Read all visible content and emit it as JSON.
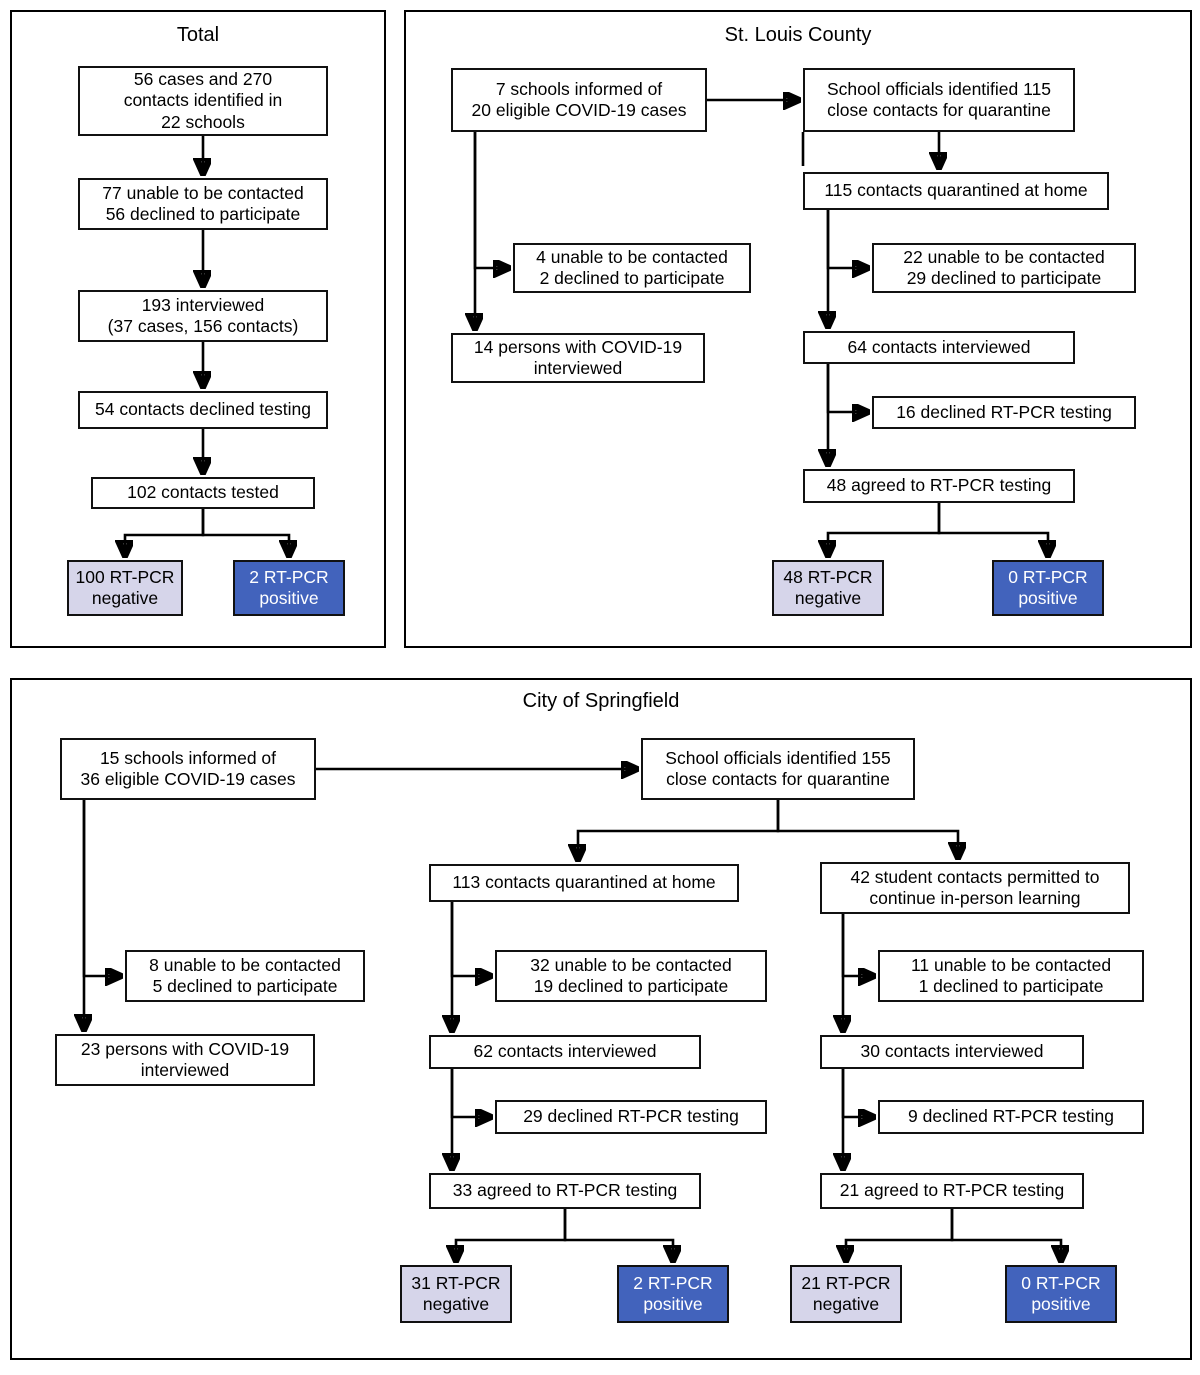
{
  "figure": {
    "panels": [
      {
        "id": "total",
        "title": "Total",
        "nodes": [
          {
            "id": "t1",
            "label": "56 cases and 270\ncontacts identified in\n22 schools",
            "style": "plain"
          },
          {
            "id": "t2",
            "label": "77 unable to be contacted\n56 declined to participate",
            "style": "plain"
          },
          {
            "id": "t3",
            "label": "193 interviewed\n(37 cases, 156 contacts)",
            "style": "plain"
          },
          {
            "id": "t4",
            "label": "54 contacts declined testing",
            "style": "plain"
          },
          {
            "id": "t5",
            "label": "102 contacts tested",
            "style": "plain"
          },
          {
            "id": "t6",
            "label": "100 RT-PCR\nnegative",
            "style": "negative"
          },
          {
            "id": "t7",
            "label": "2 RT-PCR\npositive",
            "style": "positive"
          }
        ]
      },
      {
        "id": "stlouis",
        "title": "St. Louis County",
        "nodes": [
          {
            "id": "s1",
            "label": "7 schools informed of\n20 eligible COVID-19 cases",
            "style": "plain"
          },
          {
            "id": "s2",
            "label": "School officials identified 115\nclose contacts for quarantine",
            "style": "plain"
          },
          {
            "id": "s3",
            "label": "115 contacts quarantined at home",
            "style": "plain"
          },
          {
            "id": "s4",
            "label": "4 unable to be contacted\n2 declined to participate",
            "style": "plain"
          },
          {
            "id": "s5",
            "label": "14 persons with COVID-19\ninterviewed",
            "style": "plain"
          },
          {
            "id": "s6",
            "label": "22 unable to be contacted\n29 declined to participate",
            "style": "plain"
          },
          {
            "id": "s7",
            "label": "64 contacts interviewed",
            "style": "plain"
          },
          {
            "id": "s8",
            "label": "16 declined RT-PCR testing",
            "style": "plain"
          },
          {
            "id": "s9",
            "label": "48 agreed to RT-PCR testing",
            "style": "plain"
          },
          {
            "id": "s10",
            "label": "48 RT-PCR\nnegative",
            "style": "negative"
          },
          {
            "id": "s11",
            "label": "0 RT-PCR\npositive",
            "style": "positive"
          }
        ]
      },
      {
        "id": "springfield",
        "title": "City of Springfield",
        "nodes": [
          {
            "id": "p1",
            "label": "15 schools informed of\n36 eligible COVID-19 cases",
            "style": "plain"
          },
          {
            "id": "p2",
            "label": "School officials identified 155\nclose contacts for quarantine",
            "style": "plain"
          },
          {
            "id": "p3",
            "label": "8 unable to be contacted\n5 declined to participate",
            "style": "plain"
          },
          {
            "id": "p4",
            "label": "23 persons with COVID-19\ninterviewed",
            "style": "plain"
          },
          {
            "id": "p5",
            "label": "113 contacts quarantined at home",
            "style": "plain"
          },
          {
            "id": "p6",
            "label": "42 student contacts permitted to\ncontinue in-person learning",
            "style": "plain"
          },
          {
            "id": "p7",
            "label": "32 unable to be contacted\n19 declined to participate",
            "style": "plain"
          },
          {
            "id": "p8",
            "label": "11 unable to be contacted\n1 declined to participate",
            "style": "plain"
          },
          {
            "id": "p9",
            "label": "62 contacts interviewed",
            "style": "plain"
          },
          {
            "id": "p10",
            "label": "30 contacts interviewed",
            "style": "plain"
          },
          {
            "id": "p11",
            "label": "29 declined RT-PCR testing",
            "style": "plain"
          },
          {
            "id": "p12",
            "label": "9 declined RT-PCR testing",
            "style": "plain"
          },
          {
            "id": "p13",
            "label": "33 agreed to RT-PCR testing",
            "style": "plain"
          },
          {
            "id": "p14",
            "label": "21 agreed to RT-PCR testing",
            "style": "plain"
          },
          {
            "id": "p15",
            "label": "31 RT-PCR\nnegative",
            "style": "negative"
          },
          {
            "id": "p16",
            "label": "2 RT-PCR\npositive",
            "style": "positive"
          },
          {
            "id": "p17",
            "label": "21 RT-PCR\nnegative",
            "style": "negative"
          },
          {
            "id": "p18",
            "label": "0 RT-PCR\npositive",
            "style": "positive"
          }
        ]
      }
    ],
    "colors": {
      "negative_fill": "#d6d5ea",
      "positive_fill": "#4263bc",
      "border": "#111111",
      "text": "#000000",
      "positive_text": "#ffffff"
    }
  }
}
